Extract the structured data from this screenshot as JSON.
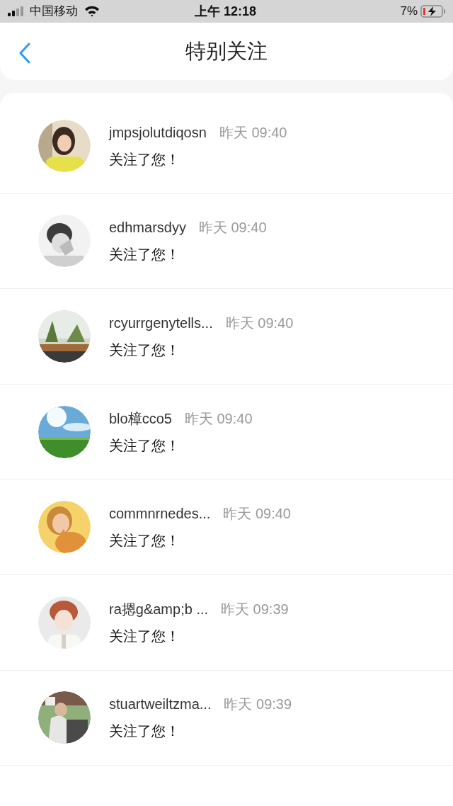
{
  "status_bar": {
    "carrier": "中国移动",
    "time": "上午 12:18",
    "battery": "7%"
  },
  "header": {
    "title": "特别关注"
  },
  "notifications": [
    {
      "name": "jmpsjolutdiqosn",
      "time": "昨天 09:40",
      "message": "关注了您！"
    },
    {
      "name": "edhmarsdyy",
      "time": "昨天 09:40",
      "message": "关注了您！"
    },
    {
      "name": "rcyurrgenytells...",
      "time": "昨天 09:40",
      "message": "关注了您！"
    },
    {
      "name": "blo樟cco5",
      "time": "昨天 09:40",
      "message": "关注了您！"
    },
    {
      "name": "commnrnedes...",
      "time": "昨天 09:40",
      "message": "关注了您！"
    },
    {
      "name": "ra摁g&amp;b ...",
      "time": "昨天 09:39",
      "message": "关注了您！"
    },
    {
      "name": "stuartweiltzma...",
      "time": "昨天 09:39",
      "message": "关注了您！"
    }
  ]
}
